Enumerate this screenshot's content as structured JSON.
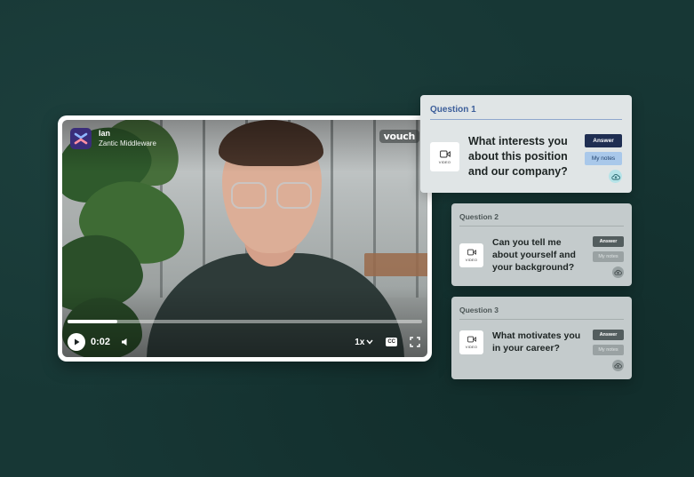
{
  "player": {
    "user_name": "Ian",
    "user_company": "Zantic Middleware",
    "brand_badge": "vouch",
    "current_time": "0:02",
    "progress_fraction": 0.14,
    "speed_label": "1x",
    "cc_label": "CC"
  },
  "questions": [
    {
      "header": "Question 1",
      "text": "What interests you about this position and our company?",
      "tile_label": "VIDEO",
      "answer_label": "Answer",
      "notes_label": "My notes",
      "active": true
    },
    {
      "header": "Question 2",
      "text": "Can you tell me about yourself and your background?",
      "tile_label": "VIDEO",
      "answer_label": "Answer",
      "notes_label": "My notes",
      "active": false
    },
    {
      "header": "Question 3",
      "text": "What motivates you in your career?",
      "tile_label": "VIDEO",
      "answer_label": "Answer",
      "notes_label": "My notes",
      "active": false
    }
  ],
  "icons": {
    "app_logo": "app-logo-icon",
    "play": "play-icon",
    "volume": "volume-icon",
    "speed_chevron": "chevron-down-icon",
    "fullscreen": "fullscreen-icon",
    "video_tile": "video-camera-icon",
    "cloud": "cloud-upload-icon"
  },
  "colors": {
    "background": "#163634",
    "active_header": "#3c5e9a",
    "active_answer": "#1f2e52",
    "active_notes": "#a9c8ea"
  }
}
